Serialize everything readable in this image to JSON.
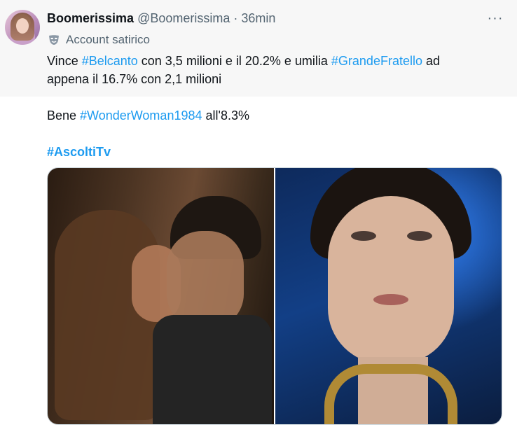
{
  "tweet": {
    "display_name": "Boomerissima",
    "handle": "@Boomerissima",
    "separator": "·",
    "time": "36min",
    "account_label": "Account satirico",
    "more_icon": "more-horizontal-icon",
    "label_icon": "mask-icon",
    "text": {
      "line1_prefix": "Vince ",
      "hashtag1": "#Belcanto",
      "line1_mid": " con 3,5 milioni e il 20.2% e umilia ",
      "hashtag2": "#GrandeFratello",
      "line1_suffix": " ad",
      "line2": "appena il 16.7% con 2,1 milioni",
      "line3_prefix": "Bene ",
      "hashtag3": "#WonderWoman1984",
      "line3_suffix": " all'8.3%",
      "hashtag4": "#AscoltiTv"
    }
  },
  "colors": {
    "text": "#0f1419",
    "secondary": "#536471",
    "link": "#1d9bf0",
    "header_background": "#f7f7f7",
    "border": "#cfd9de"
  }
}
